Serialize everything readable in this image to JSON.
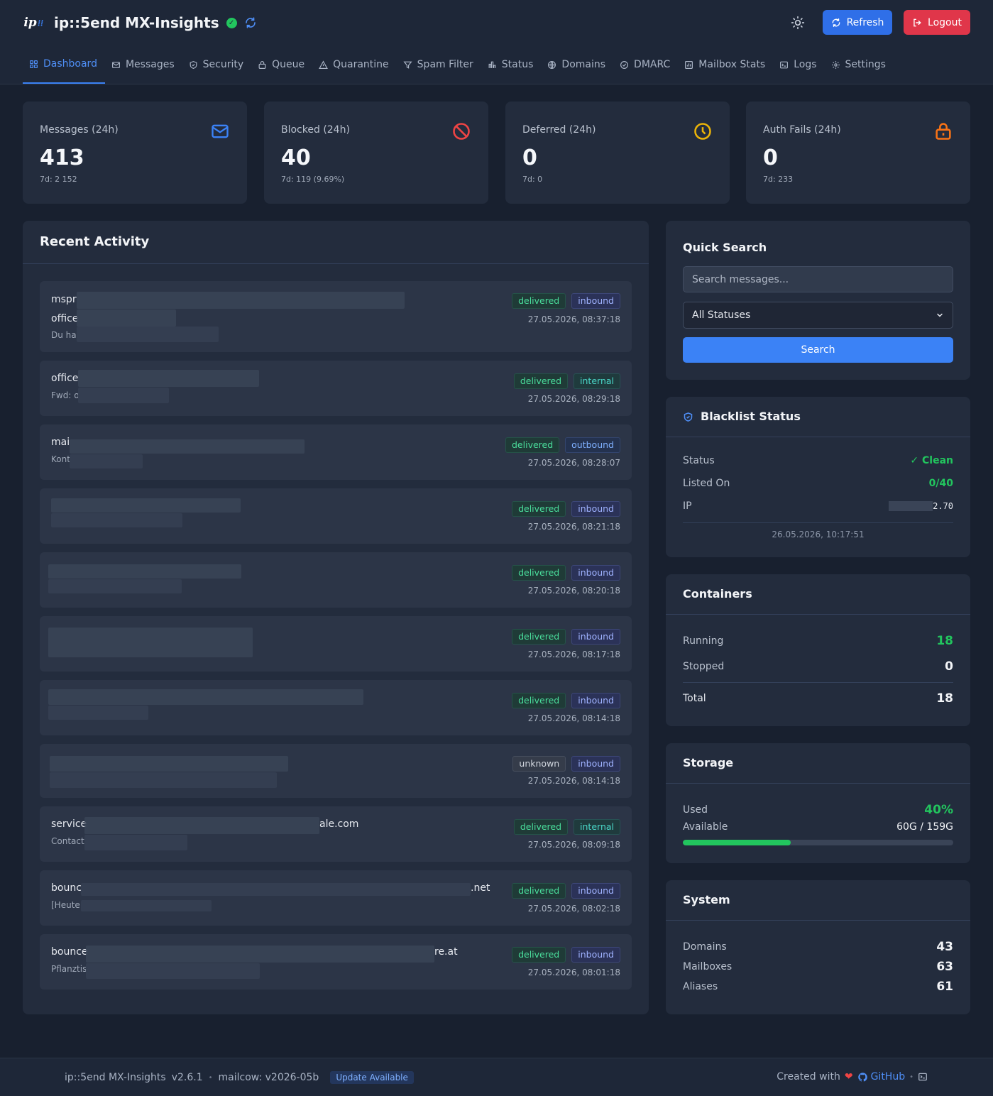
{
  "header": {
    "logo_text": "ip",
    "title": "ip::5end MX-Insights",
    "refresh_label": "Refresh",
    "logout_label": "Logout"
  },
  "nav": [
    {
      "label": "Dashboard",
      "icon": "grid-icon"
    },
    {
      "label": "Messages",
      "icon": "mail-icon"
    },
    {
      "label": "Security",
      "icon": "shield-icon"
    },
    {
      "label": "Queue",
      "icon": "lock-icon"
    },
    {
      "label": "Quarantine",
      "icon": "warning-icon"
    },
    {
      "label": "Spam Filter",
      "icon": "filter-icon"
    },
    {
      "label": "Status",
      "icon": "bar-chart-icon"
    },
    {
      "label": "Domains",
      "icon": "globe-icon"
    },
    {
      "label": "DMARC",
      "icon": "check-circle-icon"
    },
    {
      "label": "Mailbox Stats",
      "icon": "mailbox-stats-icon"
    },
    {
      "label": "Logs",
      "icon": "terminal-icon"
    },
    {
      "label": "Settings",
      "icon": "gear-icon"
    }
  ],
  "stats": [
    {
      "label": "Messages (24h)",
      "value": "413",
      "sub": "7d: 2 152",
      "icon": "envelope-icon",
      "color": "#3b82f6"
    },
    {
      "label": "Blocked (24h)",
      "value": "40",
      "sub": "7d: 119 (9.69%)",
      "icon": "blocked-icon",
      "color": "#ef4444"
    },
    {
      "label": "Deferred (24h)",
      "value": "0",
      "sub": "7d: 0",
      "icon": "clock-icon",
      "color": "#eab308"
    },
    {
      "label": "Auth Fails (24h)",
      "value": "0",
      "sub": "7d: 233",
      "icon": "padlock-icon",
      "color": "#f97316"
    }
  ],
  "activity": {
    "title": "Recent Activity",
    "items": [
      {
        "line1": "mspr",
        "line2": "office",
        "line3": "Du has",
        "status": "delivered",
        "direction": "inbound",
        "time": "27.05.2026, 08:37:18"
      },
      {
        "line1": "office",
        "line2": "Fwd: o",
        "status": "delivered",
        "direction": "internal",
        "time": "27.05.2026, 08:29:18"
      },
      {
        "line1": "mai",
        "line2": "Kont",
        "status": "delivered",
        "direction": "outbound",
        "time": "27.05.2026, 08:28:07"
      },
      {
        "line1": "",
        "line2": "",
        "status": "delivered",
        "direction": "inbound",
        "time": "27.05.2026, 08:21:18"
      },
      {
        "line1": "",
        "line2": "",
        "status": "delivered",
        "direction": "inbound",
        "time": "27.05.2026, 08:20:18"
      },
      {
        "line1": "",
        "line2": "",
        "status": "delivered",
        "direction": "inbound",
        "time": "27.05.2026, 08:17:18"
      },
      {
        "line1": "",
        "line2": "",
        "status": "delivered",
        "direction": "inbound",
        "time": "27.05.2026, 08:14:18"
      },
      {
        "line1": "",
        "line2": "",
        "status": "unknown",
        "direction": "inbound",
        "time": "27.05.2026, 08:14:18"
      },
      {
        "line1": "service",
        "line1_end": "ale.com",
        "line2": "Contact",
        "status": "delivered",
        "direction": "internal",
        "time": "27.05.2026, 08:09:18"
      },
      {
        "line1": "bounc",
        "line1_end": ".net",
        "line2": "[Heute",
        "status": "delivered",
        "direction": "inbound",
        "time": "27.05.2026, 08:02:18"
      },
      {
        "line1": "bounce",
        "line1_end": "re.at",
        "line2": "Pflanztis",
        "status": "delivered",
        "direction": "inbound",
        "time": "27.05.2026, 08:01:18"
      }
    ]
  },
  "quick_search": {
    "title": "Quick Search",
    "placeholder": "Search messages...",
    "status_selected": "All Statuses",
    "button_label": "Search"
  },
  "blacklist": {
    "title": "Blacklist Status",
    "status_label": "Status",
    "status_value": "✓ Clean",
    "listed_label": "Listed On",
    "listed_value": "0/40",
    "ip_label": "IP",
    "ip_value": "2.70",
    "checked_at": "26.05.2026, 10:17:51"
  },
  "containers": {
    "title": "Containers",
    "running_label": "Running",
    "running_value": "18",
    "stopped_label": "Stopped",
    "stopped_value": "0",
    "total_label": "Total",
    "total_value": "18"
  },
  "storage": {
    "title": "Storage",
    "used_label": "Used",
    "used_value": "40%",
    "used_fraction": 0.4,
    "available_label": "Available",
    "available_value": "60G / 159G"
  },
  "system": {
    "title": "System",
    "domains_label": "Domains",
    "domains_value": "43",
    "mailboxes_label": "Mailboxes",
    "mailboxes_value": "63",
    "aliases_label": "Aliases",
    "aliases_value": "61"
  },
  "footer": {
    "app_name": "ip::5end MX-Insights",
    "version": "v2.6.1",
    "mailcow": "mailcow: v2026-05b",
    "update_label": "Update Available",
    "created_with": "Created with",
    "github_label": "GitHub"
  },
  "colors": {
    "accent": "#3b82f6",
    "success": "#22c55e",
    "danger": "#e0364a",
    "background": "#18202f",
    "card": "#232c3d"
  }
}
